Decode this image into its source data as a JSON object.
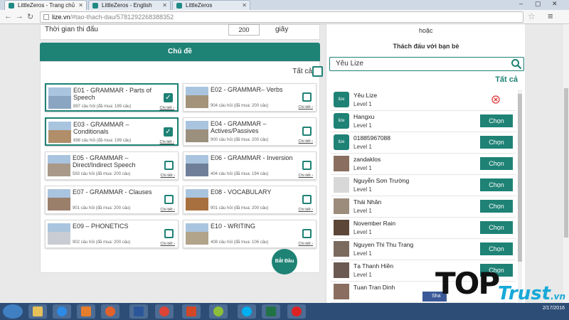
{
  "browser": {
    "tabs": [
      {
        "title": "LittleZeros - Trang chủ"
      },
      {
        "title": "LittleZeros - English"
      },
      {
        "title": "LittleZeros"
      }
    ],
    "url_host": "lize.vn",
    "url_path": "/#tao-thach-dau/5781292268388352"
  },
  "settings": {
    "time_label": "Thời gian thi đấu",
    "time_value": "200",
    "time_unit": "giây"
  },
  "topics": {
    "header": "Chủ đề",
    "select_all_label": "Tất cả",
    "detail_label": "Chi tiết",
    "items": [
      {
        "name": "E01 - GRAMMAR - Parts of Speech",
        "meta": "897 câu hỏi (đã mua: 199 câu)",
        "checked": true
      },
      {
        "name": "E02 - GRAMMAR– Verbs",
        "meta": "904 câu hỏi (đã mua: 200 câu)",
        "checked": false
      },
      {
        "name": "E03 - GRAMMAR – Conditionals",
        "meta": "898 câu hỏi (đã mua: 199 câu)",
        "checked": true
      },
      {
        "name": "E04 - GRAMMAR – Actives/Passives",
        "meta": "900 câu hỏi (đã mua: 200 câu)",
        "checked": false
      },
      {
        "name": "E05 - GRAMMAR – Direct/Indirect Speech",
        "meta": "593 câu hỏi (đã mua: 200 câu)",
        "checked": false
      },
      {
        "name": "E06 - GRAMMAR - Inversion",
        "meta": "404 câu hỏi (đã mua: 194 câu)",
        "checked": false
      },
      {
        "name": "E07 - GRAMMAR - Clauses",
        "meta": "901 câu hỏi (đã mua: 200 câu)",
        "checked": false
      },
      {
        "name": "E08 - VOCABULARY",
        "meta": "901 câu hỏi (đã mua: 200 câu)",
        "checked": false
      },
      {
        "name": "E09 – PHONETICS",
        "meta": "902 câu hỏi (đã mua: 200 câu)",
        "checked": false
      },
      {
        "name": "E10 - WRITING",
        "meta": "408 câu hỏi (đã mua: 106 câu)",
        "checked": false
      }
    ],
    "start_label": "Bắt Đầu"
  },
  "challenge": {
    "or_label": "hoặc",
    "title": "Thách đấu với bạn bè",
    "search_value": "Yêu Lize",
    "select_all_label": "Tất cả",
    "choose_label": "Chọn",
    "friends": [
      {
        "name": "Yêu Lize",
        "level": "Level 1",
        "selected": true,
        "avatar": "lize"
      },
      {
        "name": "Hangxu",
        "level": "Level 1",
        "selected": false,
        "avatar": "lize"
      },
      {
        "name": "01885967088",
        "level": "Level 1",
        "selected": false,
        "avatar": "lize"
      },
      {
        "name": "zandaklos",
        "level": "Level 1",
        "selected": false,
        "avatar": "photo"
      },
      {
        "name": "Nguyễn Sơn Trường",
        "level": "Level 1",
        "selected": false,
        "avatar": "blank"
      },
      {
        "name": "Thái Nhân",
        "level": "Level 1",
        "selected": false,
        "avatar": "photo"
      },
      {
        "name": "November Rain",
        "level": "Level 1",
        "selected": false,
        "avatar": "photo"
      },
      {
        "name": "Nguyen Thi Thu Trang",
        "level": "Level 1",
        "selected": false,
        "avatar": "photo"
      },
      {
        "name": "Tạ Thanh Hiền",
        "level": "Level 1",
        "selected": false,
        "avatar": "photo"
      },
      {
        "name": "Tuan Tran Dinh",
        "level": "",
        "selected": false,
        "avatar": "photo"
      }
    ],
    "share_label": "Sha"
  },
  "taskbar": {
    "clock_time": "",
    "clock_date": "2/17/2016"
  },
  "watermark": {
    "text1": "TOP",
    "text2": "Trust",
    "suffix": ".vn"
  },
  "colors": {
    "accent": "#1e8275",
    "link": "#17a9d8"
  }
}
